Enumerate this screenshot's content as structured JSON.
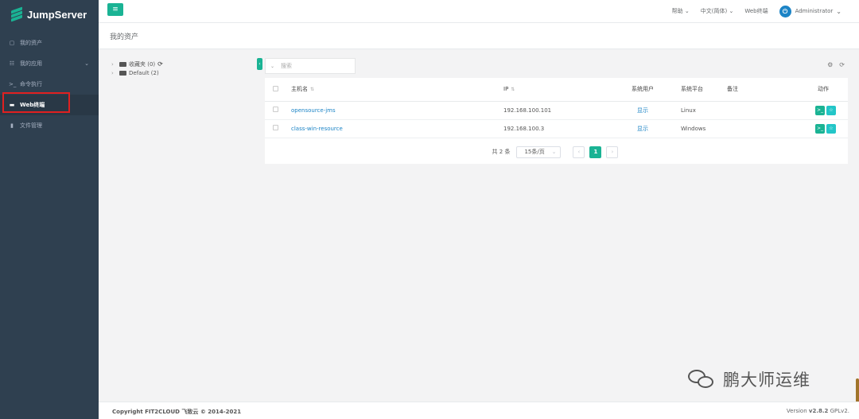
{
  "app": {
    "brand": "JumpServer"
  },
  "sidebar": {
    "items": [
      {
        "label": "我的资产",
        "icon": "cube-icon"
      },
      {
        "label": "我的应用",
        "icon": "grid-icon"
      },
      {
        "label": "命令执行",
        "icon": "terminal-icon"
      },
      {
        "label": "Web终端",
        "icon": "window-icon",
        "active": true
      },
      {
        "label": "文件管理",
        "icon": "file-icon"
      }
    ]
  },
  "topbar": {
    "help": "帮助",
    "language": "中文(简体)",
    "webterm": "Web终端",
    "user": "Administrator"
  },
  "page": {
    "title": "我的资产"
  },
  "tree": {
    "favorites": "收藏夹 (0)",
    "default": "Default (2)"
  },
  "search": {
    "placeholder": "搜索"
  },
  "table": {
    "headers": [
      "主机名",
      "IP",
      "系统用户",
      "系统平台",
      "备注",
      "动作"
    ],
    "rows": [
      {
        "hostname": "opensource-jms",
        "ip": "192.168.100.101",
        "system_user": "显示",
        "platform": "Linux",
        "note": ""
      },
      {
        "hostname": "class-win-resource",
        "ip": "192.168.100.3",
        "system_user": "显示",
        "platform": "Windows",
        "note": ""
      }
    ]
  },
  "pager": {
    "total": "共 2 条",
    "page_size": "15条/页",
    "current": "1"
  },
  "footer": {
    "copyright": "Copyright FIT2CLOUD 飞致云 © 2014-2021",
    "version_prefix": "Version",
    "version": "v2.8.2",
    "license": "GPLv2."
  },
  "watermark": {
    "text": "鹏大师运维"
  }
}
